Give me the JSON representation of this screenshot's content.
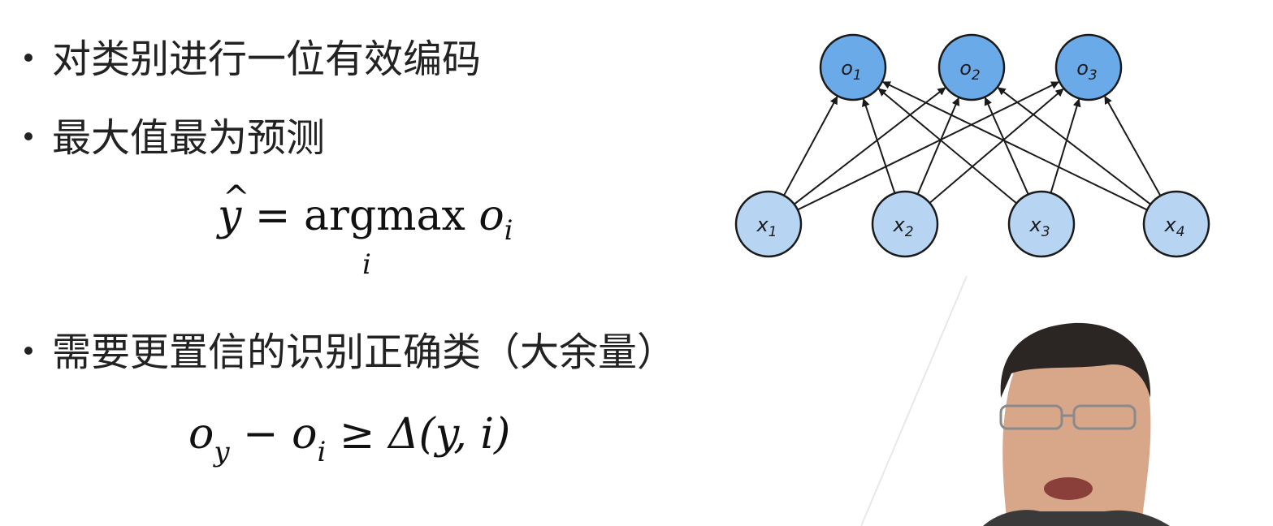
{
  "bullets": {
    "b1": "对类别进行一位有效编码",
    "b2": "最大值最为预测",
    "b3": "需要更置信的识别正确类（大余量）"
  },
  "formula1": {
    "lhs_symbol": "y",
    "hat": "^",
    "equals": " = ",
    "operator": "argmax",
    "operator_sub": "i",
    "var": " o",
    "var_sub": "i"
  },
  "formula2": {
    "o1": "o",
    "o1_sub": "y",
    "minus": " − ",
    "o2": "o",
    "o2_sub": "i",
    "geq": " ≥ ",
    "rhs": "Δ(y, i)"
  },
  "network": {
    "outputs": [
      {
        "label": "o",
        "sub": "1"
      },
      {
        "label": "o",
        "sub": "2"
      },
      {
        "label": "o",
        "sub": "3"
      }
    ],
    "inputs": [
      {
        "label": "x",
        "sub": "1"
      },
      {
        "label": "x",
        "sub": "2"
      },
      {
        "label": "x",
        "sub": "3"
      },
      {
        "label": "x",
        "sub": "4"
      }
    ],
    "connections": "fully-connected",
    "colors": {
      "output_fill": "#6aaae8",
      "input_fill": "#b7d5f2",
      "stroke": "#1a1a1a"
    }
  }
}
